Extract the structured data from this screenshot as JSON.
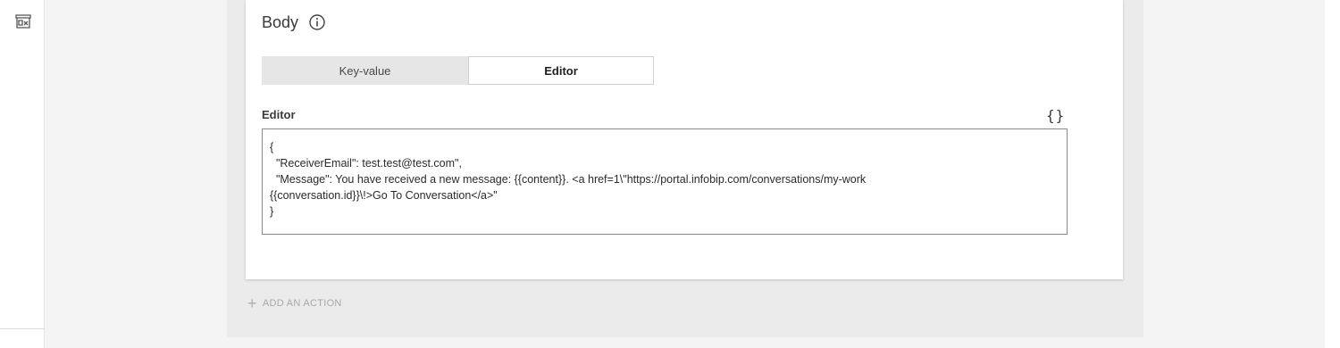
{
  "sidebar": {
    "icon": "store-icon"
  },
  "body_section": {
    "title": "Body",
    "info_icon": "info-icon",
    "tabs": [
      {
        "label": "Key-value",
        "selected": false
      },
      {
        "label": "Editor",
        "selected": true
      }
    ],
    "editor": {
      "label": "Editor",
      "format_icon": "{}",
      "lines": [
        "{",
        "  \"ReceiverEmail\": test.test@test.com\",",
        "  \"Message\": You have received a new message: {{content}}. <a href=1\\\"https://portal.infobip.com/conversations/my-work",
        "{{conversation.id}}\\!>Go To Conversation</a>\"",
        "}"
      ]
    }
  },
  "actions": {
    "add_action_label": "ADD AN ACTION"
  }
}
